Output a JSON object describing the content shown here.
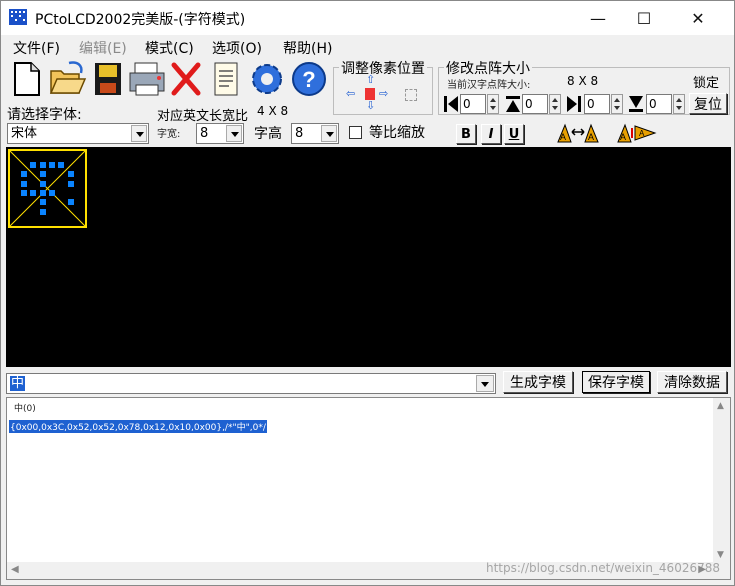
{
  "window": {
    "title": "PCtoLCD2002完美版-(字符模式)",
    "controls": {
      "minimize": "—",
      "maximize": "☐",
      "close": "✕"
    }
  },
  "menu": {
    "items": [
      {
        "label": "文件(F)",
        "enabled": true
      },
      {
        "label": "编辑(E)",
        "enabled": false
      },
      {
        "label": "模式(C)",
        "enabled": true
      },
      {
        "label": "选项(O)",
        "enabled": true
      },
      {
        "label": "帮助(H)",
        "enabled": true
      }
    ]
  },
  "toolbar": {
    "icons": [
      "new-file-icon",
      "open-folder-icon",
      "save-disk-icon",
      "print-icon",
      "delete-x-icon",
      "notepad-icon",
      "settings-gear-icon",
      "help-icon"
    ]
  },
  "pixel_adjust": {
    "title": "调整像素位置"
  },
  "lattice": {
    "title": "修改点阵大小",
    "current_label": "当前汉字点阵大小:",
    "current_value": "8 X 8",
    "lock_label": "锁定",
    "reset_label": "复位",
    "spinners": [
      "0",
      "0",
      "0",
      "0"
    ]
  },
  "font": {
    "select_label": "请选择字体:",
    "name": "宋体",
    "english_ratio_label": "对应英文长宽比",
    "english_ratio_value": "4 X 8",
    "width_label": "字宽:",
    "width_value": "8",
    "height_label": "字高",
    "height_value": "8",
    "proportional_label": "等比缩放",
    "bold": "B",
    "italic": "I",
    "underline": "U"
  },
  "glyph": {
    "width": 8,
    "height": 8,
    "rows": [
      0,
      60,
      82,
      82,
      120,
      18,
      16,
      0
    ]
  },
  "bottom": {
    "input_text": "中",
    "generate_label": "生成字模",
    "save_label": "保存字模",
    "clear_label": "清除数据"
  },
  "output": {
    "line1": "中(0)",
    "line2": "{0x00,0x3C,0x52,0x52,0x78,0x12,0x10,0x00},/*\"中\",0*/",
    "watermark": "https://blog.csdn.net/weixin_46026788"
  },
  "colors": {
    "pixel_on": "#0a84ff",
    "glyph_border": "#ffe000",
    "canvas_bg": "#000000",
    "selection": "#1e61d1"
  }
}
